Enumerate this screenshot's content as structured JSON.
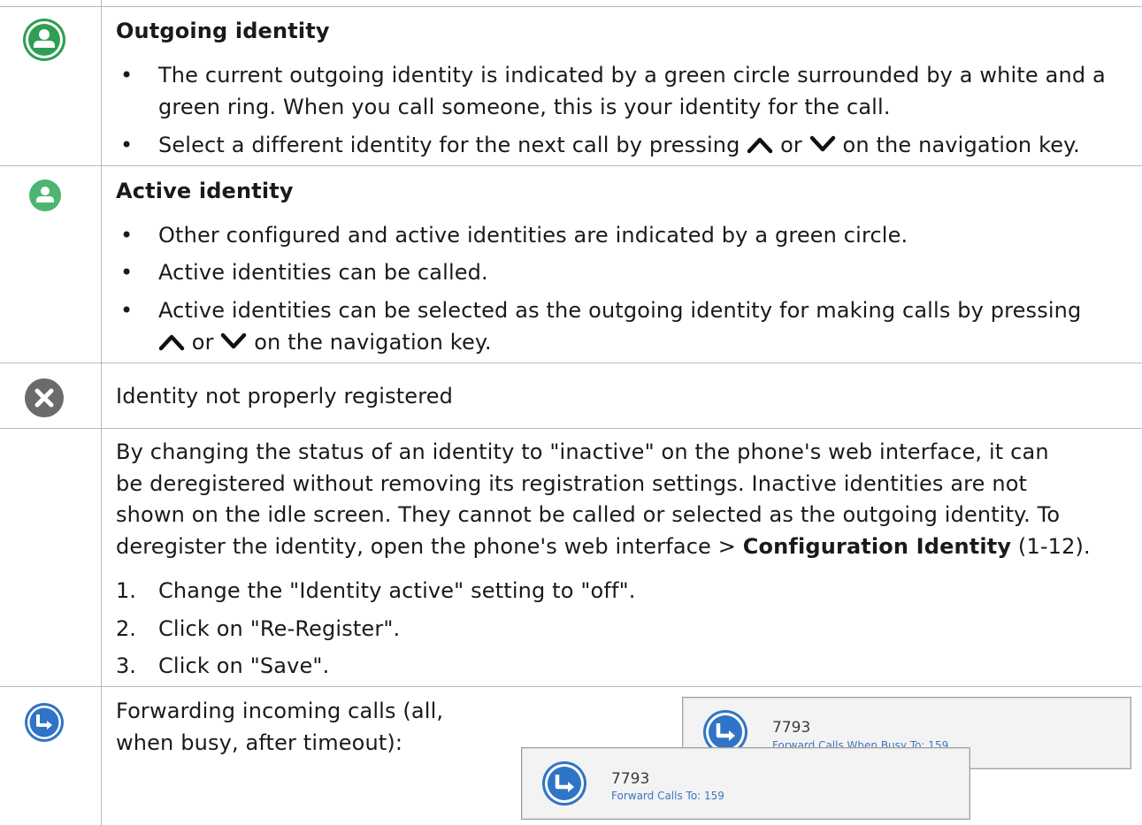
{
  "rows": {
    "outgoing": {
      "icon": "outgoing-identity-icon",
      "title": "Outgoing identity",
      "bullet1_line1": "The current outgoing identity is indicated by a green circle surrounded by a white and a",
      "bullet1_line2": "green ring. When you call someone, this is your identity for the call.",
      "bullet2_pre": "Select a different identity for the next call by pressing",
      "bullet2_or": "or",
      "bullet2_post": "on the navigation key."
    },
    "active": {
      "icon": "active-identity-icon",
      "title": "Active identity",
      "bullet1": "Other configured and active identities are indicated by a green circle.",
      "bullet2": "Active identities can be called.",
      "bullet3_line1": "Active identities can be selected as the outgoing identity for making calls by pressing",
      "bullet3_or": "or",
      "bullet3_post": "on the navigation key."
    },
    "not_registered": {
      "icon": "not-registered-icon",
      "text": "Identity not properly registered"
    },
    "inactive": {
      "p1": "By changing the status of an identity to \"inactive\" on the phone's web interface, it can",
      "p2": "be deregistered without removing its registration settings.  Inactive identities are not",
      "p3": "shown on the idle screen.  They cannot be called or selected as the outgoing identity.  To",
      "p4_pre": "deregister the identity, open the phone's web interface  >  ",
      "p4_bold": "Configuration Identity",
      "p4_post": " (1-12).",
      "steps": [
        {
          "n": "1.",
          "text": "Change the \"Identity active\" setting to \"off\"."
        },
        {
          "n": "2.",
          "text": "Click on \"Re-Register\"."
        },
        {
          "n": "3.",
          "text": "Click on \"Save\"."
        }
      ]
    },
    "forwarding": {
      "icon": "forwarding-icon",
      "line1": "Forwarding incoming calls (all,",
      "line2": "when busy, after timeout):",
      "card_back": {
        "number": "7793",
        "status": "Forward Calls When Busy To: 159"
      },
      "card_front": {
        "number": "7793",
        "status": "Forward Calls To: 159"
      }
    }
  },
  "colors": {
    "green": "#2e9e52",
    "green_light": "#4cb56f",
    "gray_icon": "#6b6b6b",
    "blue": "#2f74c6",
    "grid": "#b9b9b9"
  },
  "bullet_glyph": "•"
}
